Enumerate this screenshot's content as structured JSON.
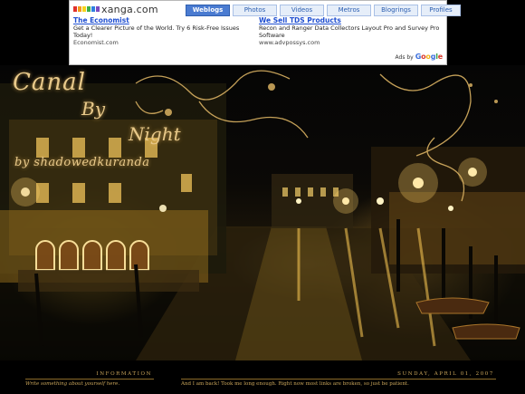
{
  "adbar": {
    "brand": "xanga.com",
    "brand_colors": [
      "#e0322b",
      "#f39b1c",
      "#f6d31b",
      "#3fae49",
      "#2d7fe0",
      "#7b4cc0"
    ],
    "tabs": [
      {
        "label": "Weblogs",
        "active": true
      },
      {
        "label": "Photos",
        "active": false
      },
      {
        "label": "Videos",
        "active": false
      },
      {
        "label": "Metros",
        "active": false
      },
      {
        "label": "Blogrings",
        "active": false
      },
      {
        "label": "Profiles",
        "active": false
      }
    ],
    "ads": [
      {
        "title": "The Economist",
        "description": "Get a Clearer Picture of the World. Try 6 Risk-Free Issues Today!",
        "url": "Economist.com"
      },
      {
        "title": "We Sell TDS Products",
        "description": "Recon and Ranger Data Collectors Layout Pro and Survey Pro Software",
        "url": "www.advpossys.com"
      }
    ],
    "ads_by": "Ads by",
    "google": "Google"
  },
  "header": {
    "title_canal": "Canal",
    "title_by": "By",
    "title_night": "Night",
    "credit": "by shadowedkuranda"
  },
  "footer": {
    "sidebar_heading": "INFORMATION",
    "sidebar_text": "Write something about yourself here.",
    "date": "SUNDAY, APRIL 01, 2007",
    "post_text": "And I am back! Took me long enough. Right now most links are broken, so just be patient."
  },
  "colors": {
    "gold": "#e8c98a",
    "footer_text": "#c8a45a",
    "link_blue": "#1f4fd1",
    "tab_active": "#4a7bd1"
  }
}
